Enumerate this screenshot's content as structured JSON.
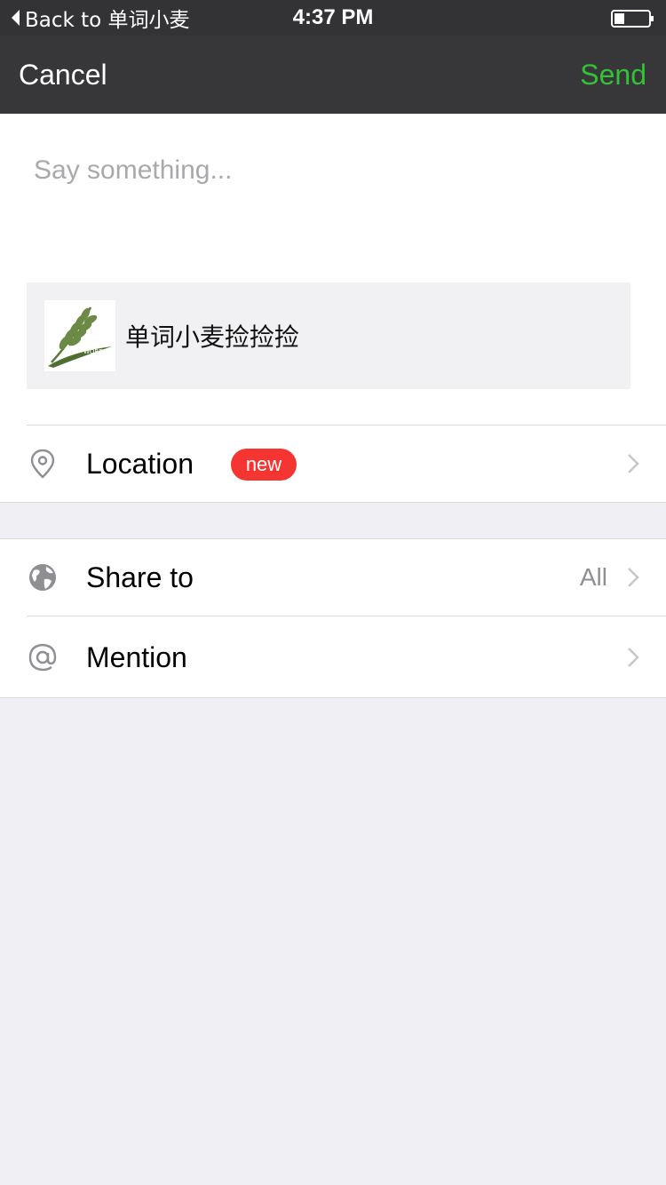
{
  "status_bar": {
    "back_label": "Back to 单词小麦",
    "time": "4:37 PM",
    "battery_level": 0.3
  },
  "nav": {
    "cancel_label": "Cancel",
    "send_label": "Send"
  },
  "compose": {
    "placeholder": "Say something...",
    "value": ""
  },
  "link_card": {
    "title": "单词小麦捡捡捡",
    "thumb_text": "WORD"
  },
  "rows": {
    "location": {
      "label": "Location",
      "badge": "new",
      "icon": "location-pin-icon"
    },
    "share_to": {
      "label": "Share to",
      "value": "All",
      "icon": "globe-icon"
    },
    "mention": {
      "label": "Mention",
      "icon": "at-icon"
    }
  },
  "colors": {
    "send_green": "#33c136",
    "badge_red": "#f43531",
    "nav_bg": "#37373a",
    "page_bg": "#efeff4"
  }
}
